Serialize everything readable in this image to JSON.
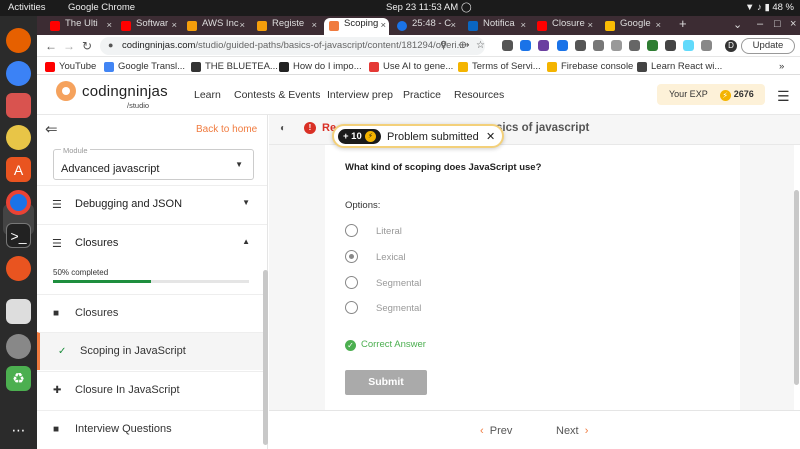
{
  "system": {
    "activities": "Activities",
    "app": "Google Chrome",
    "datetime": "Sep 23  11:53 AM",
    "battery": "48 %"
  },
  "tabs": [
    {
      "label": "The Ulti",
      "color": "#ff0000"
    },
    {
      "label": "Softwar",
      "color": "#ff0000"
    },
    {
      "label": "AWS Inc",
      "color": "#f59e0b"
    },
    {
      "label": "Registe",
      "color": "#f59e0b"
    },
    {
      "label": "Scoping",
      "color": "#f07b3f"
    },
    {
      "label": "25:48 - C",
      "color": "#1a73e8"
    },
    {
      "label": "Notifica",
      "color": "#0a66c2"
    },
    {
      "label": "Closure",
      "color": "#ff0000"
    },
    {
      "label": "Google",
      "color": "#fbbc04"
    }
  ],
  "address": {
    "host": "codingninjas.com",
    "path": "/studio/guided-paths/basics-of-javascript/content/181294/offeri...",
    "update": "Update",
    "profile": "D"
  },
  "bookmarks": [
    {
      "label": "YouTube",
      "color": "#ff0000"
    },
    {
      "label": "Google Transl...",
      "color": "#4285f4"
    },
    {
      "label": "THE BLUETEA...",
      "color": "#333333"
    },
    {
      "label": "How do I impo...",
      "color": "#222222"
    },
    {
      "label": "Use AI to gene...",
      "color": "#e53935"
    },
    {
      "label": "Terms of Servi...",
      "color": "#f4b400"
    },
    {
      "label": "Firebase console",
      "color": "#f4b400"
    },
    {
      "label": "Learn React wi...",
      "color": "#444444"
    }
  ],
  "site": {
    "logo": "codingninjas",
    "logo_sub": "/studio",
    "nav": [
      "Learn",
      "Contests & Events",
      "Interview prep",
      "Practice",
      "Resources"
    ],
    "exp_label": "Your EXP",
    "exp_value": "2676"
  },
  "sidebar": {
    "back_to_home": "Back to home",
    "module_label": "Module",
    "module_value": "Advanced javascript",
    "sections": [
      {
        "label": "Debugging and JSON"
      },
      {
        "label": "Closures"
      }
    ],
    "progress_text": "50% completed",
    "progress": 0.5,
    "items": [
      {
        "label": "Closures",
        "icon": "document-icon"
      },
      {
        "label": "Scoping in JavaScript",
        "icon": "check-icon"
      },
      {
        "label": "Closure In JavaScript",
        "icon": "puzzle-icon"
      },
      {
        "label": "Interview Questions",
        "icon": "document-icon"
      }
    ]
  },
  "main": {
    "report_label": "Re",
    "title": "sics of javascript",
    "toast_points": "+ 10",
    "toast_message": "Problem submitted",
    "question": "What kind of scoping does JavaScript use?",
    "options_label": "Options:",
    "options": [
      "Literal",
      "Lexical",
      "Segmental",
      "Segmental"
    ],
    "selected_option": 1,
    "correct_text": "Correct Answer",
    "submit": "Submit",
    "prev": "Prev",
    "next": "Next"
  }
}
